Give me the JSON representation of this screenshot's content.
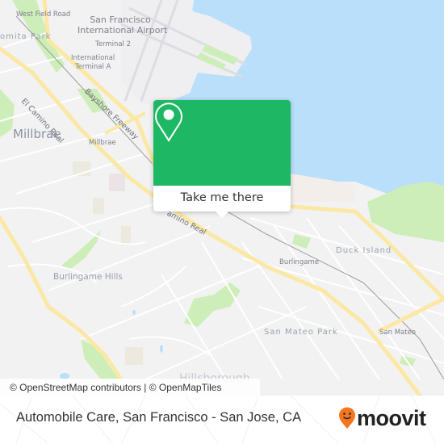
{
  "map": {
    "labels": {
      "west_field_road": "West Field Road",
      "lomita_park": "omita Park",
      "airport": "San Francisco",
      "airport_line2": "International Airport",
      "terminal_2": "Terminal 2",
      "intl_terminal": "International",
      "intl_terminal_line2": "Terminal A",
      "el_camino_real": "El Camino Real",
      "el_camino_real_2": "amino Real",
      "bayshore_freeway": "Bayshore Freeway",
      "millbrae_town": "Millbrae",
      "millbrae_station": "Millbrae",
      "burlingame_hills": "Burlingame Hills",
      "burlingame": "Burlingame",
      "duck_island": "Duck Island",
      "san_mateo_park": "San Mateo Park",
      "san_mateo": "San Mateo",
      "hillsborough": "Hillsborough"
    },
    "attribution": "© OpenStreetMap contributors | © OpenMapTiles",
    "colors": {
      "land": "#f2f2f3",
      "water": "#b9dffb",
      "park": "#cdeeb8",
      "major_road": "#fbe8a4",
      "minor_road": "#ffffff",
      "rail": "#9a9a9a"
    }
  },
  "popup": {
    "icon": "map-pin-icon",
    "action_label": "Take me there",
    "color": "#1eb865"
  },
  "footer": {
    "title": "Automobile Care, San Francisco - San Jose, CA",
    "brand": "moovit",
    "brand_icon": "moovit-pin-smile-icon",
    "brand_color": "#f5761f"
  }
}
